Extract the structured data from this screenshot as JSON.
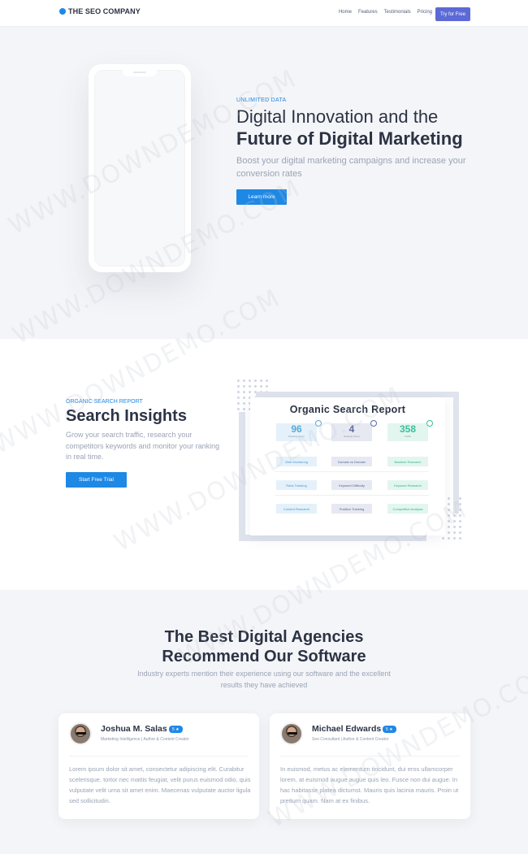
{
  "nav": {
    "brand": "THE SEO COMPANY",
    "links": [
      "Home",
      "Features",
      "Testimonials",
      "Pricing"
    ],
    "cta": "Try for Free",
    "accent": "#5c6ad6"
  },
  "hero": {
    "eyebrow": "UNLIMITED DATA",
    "title_line1": "Digital Innovation and the",
    "title_line2": "Future of Digital Marketing",
    "subtitle": "Boost your digital marketing campaigns and increase your conversion rates",
    "button": "Learn more",
    "accent": "#1e88e5"
  },
  "insights": {
    "eyebrow": "ORGANIC SEARCH REPORT",
    "title": "Search Insights",
    "subtitle": "Grow your search traffic, research your competitors keywords and monitor your ranking in real time.",
    "button": "Start Free Trial",
    "report": {
      "title": "Organic Search Report",
      "stats": [
        {
          "value": "96",
          "label": "Ranking Score",
          "color": "#5aa8d8",
          "bg": "#e4f1fa"
        },
        {
          "value": "4",
          "label": "Ranking Score",
          "color": "#5f6b9a",
          "bg": "#e6e9f2"
        },
        {
          "value": "358",
          "label": "Traffic",
          "color": "#3bbf98",
          "bg": "#e2f6ef"
        }
      ],
      "features": [
        [
          "Web Monitoring",
          "Domain vs Domain",
          "Backlink Research"
        ],
        [
          "Rank Tracking",
          "Keyword Difficulty",
          "Keyword Research"
        ],
        [
          "Content Research",
          "Position Tracking",
          "Competitive Analysis"
        ]
      ]
    }
  },
  "agencies": {
    "title_line1": "The Best Digital Agencies",
    "title_line2": "Recommend Our Software",
    "subtitle": "Industry experts mention their experience using our software and the excellent results they have achieved",
    "testimonials": [
      {
        "name": "Joshua M. Salas",
        "rating": "5 ★",
        "role": "Marketing Intelligence | Author & Content Creator",
        "quote": "Lorem ipsum dolor sit amet, consectetur adipiscing elit. Curabitur scelerisque, tortor nec mattis feugiat, velit purus euismod odio, quis vulputate velit urna sit amet enim. Maecenas vulputate auctor ligula sed sollicitudin."
      },
      {
        "name": "Michael Edwards",
        "rating": "5 ★",
        "role": "Seo Consultant | Author & Content Creator",
        "quote": "In euismod, metus ac elementum tincidunt, dui eros ullamcorper lorem, at euismod augue augue quis leo. Fusce non dui augue. In hac habitasse platea dictumst. Mauris quis lacinia mauris. Proin ut pretium quam. Nam at ex finibus."
      }
    ]
  },
  "watermark": "WWW.DOWNDEMO.COM"
}
